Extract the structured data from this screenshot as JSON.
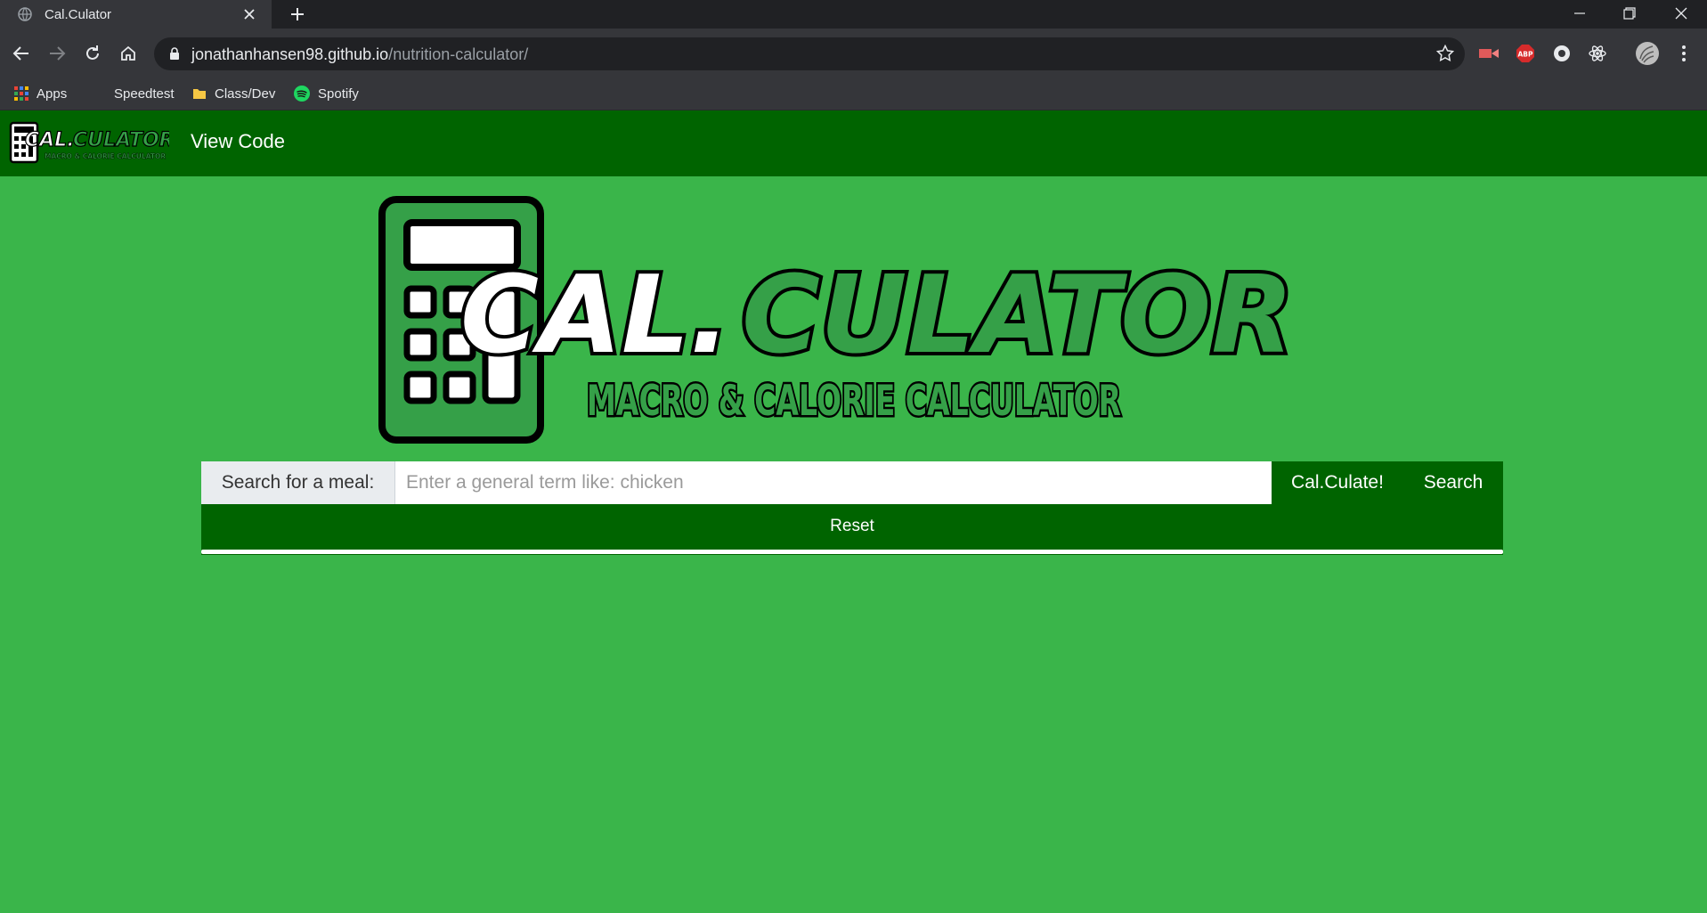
{
  "browser": {
    "tab_title": "Cal.Culator",
    "url_host": "jonathanhansen98.github.io",
    "url_path": "/nutrition-calculator/",
    "bookmarks": [
      {
        "label": "Apps",
        "icon": "apps-grid-icon"
      },
      {
        "label": "Speedtest",
        "icon": "speedtest-icon"
      },
      {
        "label": "Class/Dev",
        "icon": "folder-icon"
      },
      {
        "label": "Spotify",
        "icon": "spotify-icon"
      }
    ],
    "extensions": [
      "video-ext-icon",
      "adblock-plus-icon",
      "extension-circle-icon",
      "react-devtools-icon",
      "profile-avatar-icon"
    ]
  },
  "navbar": {
    "logo_main": "CAL.CULATOR",
    "logo_sub": "MACRO & CALORIE CALCULATOR",
    "link_label": "View Code"
  },
  "hero": {
    "title_part1": "CAL.",
    "title_part2": "CULATOR",
    "subtitle": "MACRO & CALORIE CALCULATOR"
  },
  "search": {
    "label": "Search for a meal:",
    "placeholder": "Enter a general term like: chicken",
    "value": "",
    "calculate_label": "Cal.Culate!",
    "search_label": "Search",
    "reset_label": "Reset"
  },
  "colors": {
    "page_bg": "#3ab54a",
    "nav_bg": "#006400",
    "accent_green": "#35a048"
  }
}
